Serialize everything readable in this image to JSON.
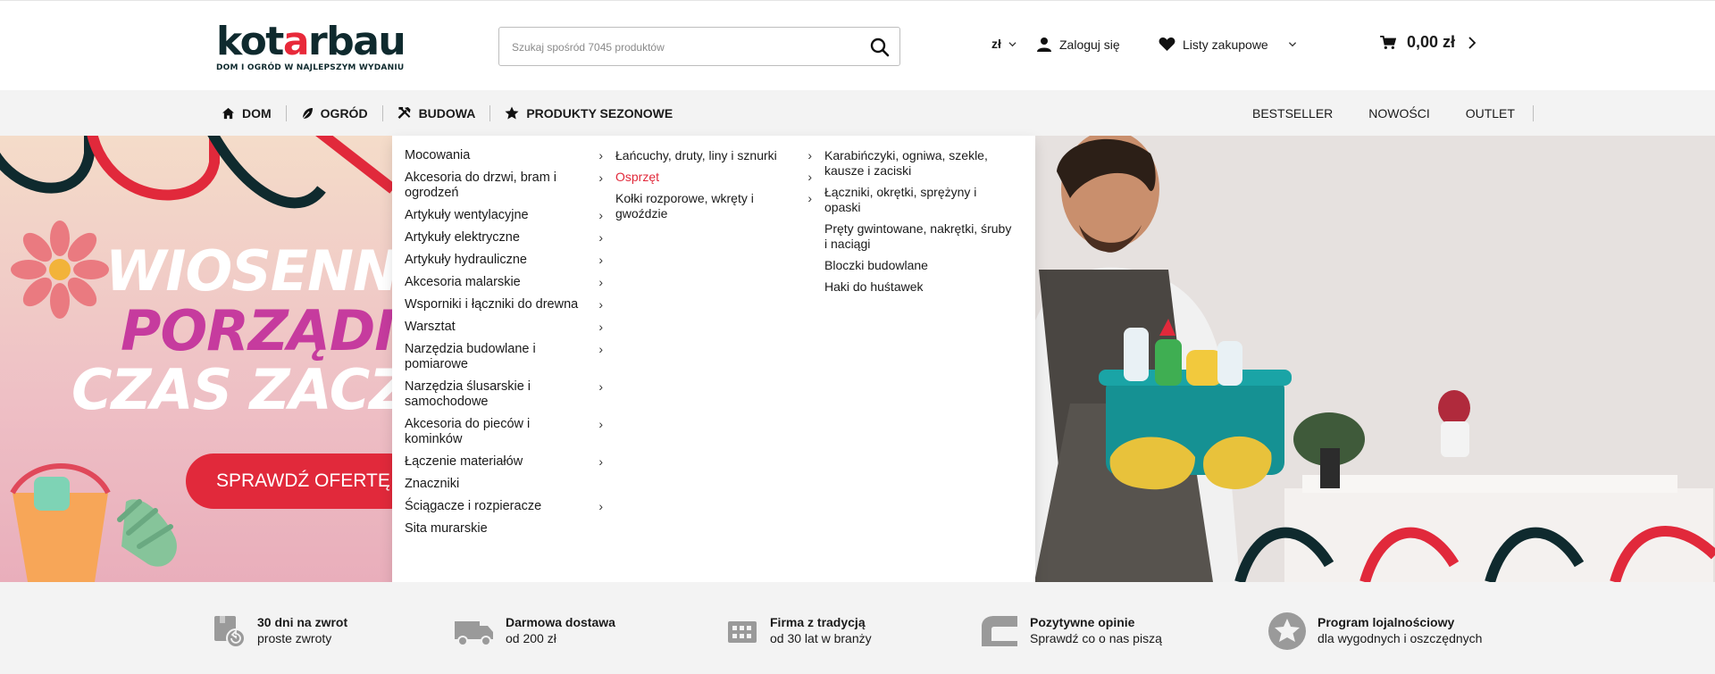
{
  "logo": {
    "word_start": "kot",
    "word_accent": "a",
    "word_end": "rbau",
    "tagline": "DOM I OGRÓD W NAJLEPSZYM WYDANIU"
  },
  "search": {
    "placeholder": "Szukaj spośród 7045 produktów"
  },
  "header": {
    "currency": "zł",
    "login": "Zaloguj się",
    "lists": "Listy zakupowe",
    "cart_total": "0,00 zł"
  },
  "nav": {
    "items": [
      {
        "label": "DOM"
      },
      {
        "label": "OGRÓD"
      },
      {
        "label": "BUDOWA"
      },
      {
        "label": "PRODUKTY SEZONOWE"
      }
    ],
    "right": [
      "BESTSELLER",
      "NOWOŚCI",
      "OUTLET"
    ]
  },
  "banner": {
    "line1": "WIOSENN",
    "line2": "PORZĄDI",
    "line3": "CZAS ZACZ",
    "cta": "SPRAWDŹ OFERTĘ"
  },
  "mega": {
    "col1": [
      {
        "label": "Mocowania",
        "arrow": true
      },
      {
        "label": "Akcesoria do drzwi, bram i ogrodzeń",
        "arrow": true
      },
      {
        "label": "Artykuły wentylacyjne",
        "arrow": true
      },
      {
        "label": "Artykuły elektryczne",
        "arrow": true
      },
      {
        "label": "Artykuły hydrauliczne",
        "arrow": true
      },
      {
        "label": "Akcesoria malarskie",
        "arrow": true
      },
      {
        "label": "Wsporniki i łączniki do drewna",
        "arrow": true
      },
      {
        "label": "Warsztat",
        "arrow": true
      },
      {
        "label": "Narzędzia budowlane i pomiarowe",
        "arrow": true
      },
      {
        "label": "Narzędzia ślusarskie i samochodowe",
        "arrow": true
      },
      {
        "label": "Akcesoria do pieców i kominków",
        "arrow": true
      },
      {
        "label": "Łączenie materiałów",
        "arrow": true
      },
      {
        "label": "Znaczniki",
        "arrow": false
      },
      {
        "label": "Ściągacze i rozpieracze",
        "arrow": true
      },
      {
        "label": "Sita murarskie",
        "arrow": false
      }
    ],
    "col2": [
      {
        "label": "Łańcuchy, druty, liny i sznurki",
        "arrow": true
      },
      {
        "label": "Osprzęt",
        "arrow": true,
        "active": true
      },
      {
        "label": "Kołki rozporowe, wkręty i gwoździe",
        "arrow": true
      }
    ],
    "col3": [
      {
        "label": "Karabińczyki, ogniwa, szekle, kausze i zaciski"
      },
      {
        "label": "Łączniki, okrętki, sprężyny i opaski"
      },
      {
        "label": "Pręty gwintowane, nakrętki, śruby i naciągi"
      },
      {
        "label": "Bloczki budowlane"
      },
      {
        "label": "Haki do huśtawek"
      }
    ]
  },
  "features": [
    {
      "title": "30 dni na zwrot",
      "sub": "proste zwroty",
      "icon": "return-box-icon"
    },
    {
      "title": "Darmowa dostawa",
      "sub": "od 200 zł",
      "icon": "truck-icon"
    },
    {
      "title": "Firma z tradycją",
      "sub": "od 30 lat w branży",
      "icon": "building-icon"
    },
    {
      "title": "Pozytywne opinie",
      "sub": "Sprawdź co o nas piszą",
      "icon": "chat-icon"
    },
    {
      "title": "Program lojalnościowy",
      "sub": "dla wygodnych i oszczędnych",
      "icon": "star-badge-icon"
    }
  ],
  "colors": {
    "brand_red": "#e1293b",
    "brand_dark": "#0f2a2e",
    "magenta": "#c63b9e",
    "nav_bg": "#f3f3f3"
  }
}
